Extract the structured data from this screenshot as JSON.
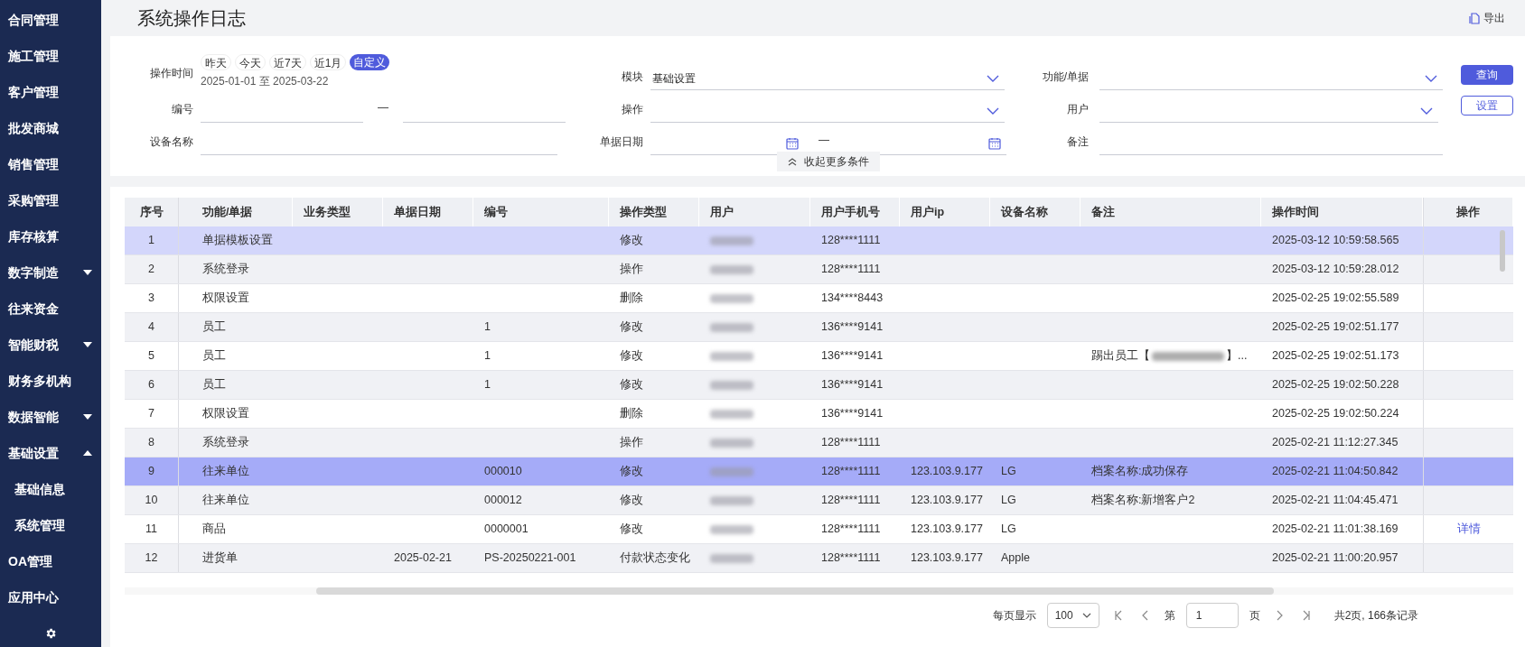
{
  "sidebar": {
    "items": [
      {
        "label": "合同管理",
        "kind": "item"
      },
      {
        "label": "施工管理",
        "kind": "item"
      },
      {
        "label": "客户管理",
        "kind": "item"
      },
      {
        "label": "批发商城",
        "kind": "item"
      },
      {
        "label": "销售管理",
        "kind": "item"
      },
      {
        "label": "采购管理",
        "kind": "item"
      },
      {
        "label": "库存核算",
        "kind": "item"
      },
      {
        "label": "数字制造",
        "kind": "group",
        "expanded": false
      },
      {
        "label": "往来资金",
        "kind": "item"
      },
      {
        "label": "智能财税",
        "kind": "group",
        "expanded": false
      },
      {
        "label": "财务多机构",
        "kind": "item"
      },
      {
        "label": "数据智能",
        "kind": "group",
        "expanded": false
      },
      {
        "label": "基础设置",
        "kind": "group",
        "expanded": true,
        "children": [
          {
            "label": "基础信息"
          },
          {
            "label": "系统管理"
          }
        ]
      },
      {
        "label": "OA管理",
        "kind": "item"
      },
      {
        "label": "应用中心",
        "kind": "item"
      }
    ]
  },
  "page": {
    "title": "系统操作日志",
    "export_label": "导出"
  },
  "filters": {
    "time_label": "操作时间",
    "time_presets": [
      {
        "label": "昨天",
        "selected": false
      },
      {
        "label": "今天",
        "selected": false
      },
      {
        "label": "近7天",
        "selected": false
      },
      {
        "label": "近1月",
        "selected": false
      },
      {
        "label": "自定义",
        "selected": true
      }
    ],
    "date_range": "2025-01-01 至 2025-03-22",
    "number_label": "编号",
    "range_dash": "—",
    "device_label": "设备名称",
    "module_label": "模块",
    "module_value": "基础设置",
    "operation_label": "操作",
    "doc_date_label": "单据日期",
    "doc_date_dash": "—",
    "function_label": "功能/单据",
    "user_label": "用户",
    "remark_label": "备注",
    "query_button": "查询",
    "settings_button": "设置",
    "collapse_label": "收起更多条件"
  },
  "table": {
    "columns": [
      "序号",
      "功能/单据",
      "业务类型",
      "单据日期",
      "编号",
      "操作类型",
      "用户",
      "用户手机号",
      "用户ip",
      "设备名称",
      "备注",
      "操作时间",
      "操作"
    ],
    "rows": [
      {
        "no": "1",
        "function": "单据模板设置",
        "doc_date": "",
        "code": "",
        "op_type": "修改",
        "phone": "128****1111",
        "ip": "",
        "device": "",
        "remark": "",
        "time": "2025-03-12 10:59:58.565",
        "action": "",
        "selected": false,
        "hovered": true
      },
      {
        "no": "2",
        "function": "系统登录",
        "doc_date": "",
        "code": "",
        "op_type": "操作",
        "phone": "128****1111",
        "ip": "",
        "device": "",
        "remark": "",
        "time": "2025-03-12 10:59:28.012",
        "action": "",
        "selected": false,
        "hovered": false
      },
      {
        "no": "3",
        "function": "权限设置",
        "doc_date": "",
        "code": "",
        "op_type": "删除",
        "phone": "134****8443",
        "ip": "",
        "device": "",
        "remark": "",
        "time": "2025-02-25 19:02:55.589",
        "action": "",
        "selected": false,
        "hovered": false
      },
      {
        "no": "4",
        "function": "员工",
        "doc_date": "",
        "code": "1",
        "op_type": "修改",
        "phone": "136****9141",
        "ip": "",
        "device": "",
        "remark": "",
        "time": "2025-02-25 19:02:51.177",
        "action": "",
        "selected": false,
        "hovered": false
      },
      {
        "no": "5",
        "function": "员工",
        "doc_date": "",
        "code": "1",
        "op_type": "修改",
        "phone": "136****9141",
        "ip": "",
        "device": "",
        "remark": "踢出员工【",
        "remark_end": "】...",
        "time": "2025-02-25 19:02:51.173",
        "action": "",
        "selected": false,
        "hovered": false
      },
      {
        "no": "6",
        "function": "员工",
        "doc_date": "",
        "code": "1",
        "op_type": "修改",
        "phone": "136****9141",
        "ip": "",
        "device": "",
        "remark": "",
        "time": "2025-02-25 19:02:50.228",
        "action": "",
        "selected": false,
        "hovered": false
      },
      {
        "no": "7",
        "function": "权限设置",
        "doc_date": "",
        "code": "",
        "op_type": "删除",
        "phone": "136****9141",
        "ip": "",
        "device": "",
        "remark": "",
        "time": "2025-02-25 19:02:50.224",
        "action": "",
        "selected": false,
        "hovered": false
      },
      {
        "no": "8",
        "function": "系统登录",
        "doc_date": "",
        "code": "",
        "op_type": "操作",
        "phone": "128****1111",
        "ip": "",
        "device": "",
        "remark": "",
        "time": "2025-02-21 11:12:27.345",
        "action": "",
        "selected": false,
        "hovered": false
      },
      {
        "no": "9",
        "function": "往来单位",
        "doc_date": "",
        "code": "000010",
        "op_type": "修改",
        "phone": "128****1111",
        "ip": "123.103.9.177",
        "device": "LG",
        "remark": "档案名称:成功保存",
        "time": "2025-02-21 11:04:50.842",
        "action": "",
        "selected": true,
        "hovered": false
      },
      {
        "no": "10",
        "function": "往来单位",
        "doc_date": "",
        "code": "000012",
        "op_type": "修改",
        "phone": "128****1111",
        "ip": "123.103.9.177",
        "device": "LG",
        "remark": "档案名称:新增客户2",
        "time": "2025-02-21 11:04:45.471",
        "action": "",
        "selected": false,
        "hovered": false
      },
      {
        "no": "11",
        "function": "商品",
        "doc_date": "",
        "code": "0000001",
        "op_type": "修改",
        "phone": "128****1111",
        "ip": "123.103.9.177",
        "device": "LG",
        "remark": "",
        "time": "2025-02-21 11:01:38.169",
        "action": "详情",
        "selected": false,
        "hovered": false
      },
      {
        "no": "12",
        "function": "进货单",
        "doc_date": "2025-02-21",
        "code": "PS-20250221-001",
        "op_type": "付款状态变化",
        "phone": "128****1111",
        "ip": "123.103.9.177",
        "device": "Apple",
        "remark": "",
        "time": "2025-02-21 11:00:20.957",
        "action": "",
        "selected": false,
        "hovered": false
      }
    ]
  },
  "pagination": {
    "page_size_label": "每页显示",
    "page_size": "100",
    "page_label": "第",
    "page": "1",
    "page_suffix": "页",
    "summary": "共2页, 166条记录"
  }
}
